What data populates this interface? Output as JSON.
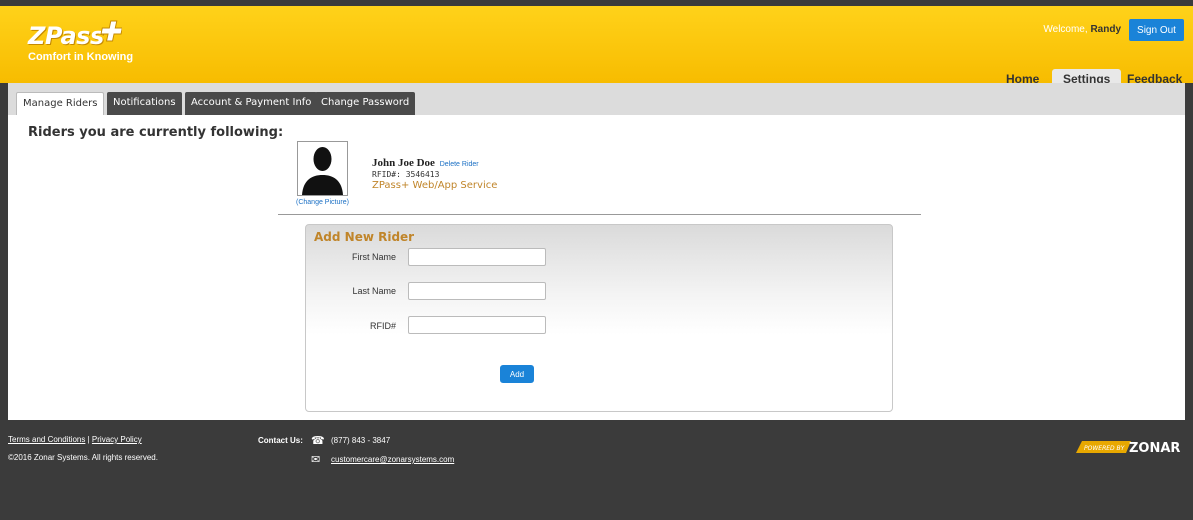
{
  "header": {
    "logo_text": "ZPass",
    "tagline": "Comfort in Knowing",
    "welcome_prefix": "Welcome,",
    "user_name": "Randy",
    "signout_label": "Sign Out",
    "nav": [
      {
        "label": "Home"
      },
      {
        "label": "Settings",
        "active": true
      },
      {
        "label": "Feedback"
      }
    ],
    "brand_color": "#f7bc00"
  },
  "tabs": [
    {
      "label": "Manage Riders",
      "active": true
    },
    {
      "label": "Notifications"
    },
    {
      "label": "Account & Payment Info"
    },
    {
      "label": "Change Password"
    }
  ],
  "main": {
    "heading": "Riders you are currently following:",
    "rider": {
      "name": "John Joe Doe",
      "delete_label": "Delete Rider",
      "rfid": "RFID#: 3546413",
      "service": "ZPass+ Web/App Service",
      "change_picture": "(Change Picture)",
      "avatar_icon": "person-silhouette-icon"
    },
    "add_form": {
      "title": "Add New Rider",
      "first_name_label": "First Name",
      "first_name_value": "",
      "last_name_label": "Last Name",
      "last_name_value": "",
      "rfid_label": "RFID#",
      "rfid_value": "",
      "add_label": "Add"
    }
  },
  "footer": {
    "terms": "Terms and Conditions",
    "separator": "|",
    "privacy": "Privacy Policy",
    "copyright": "©2016 Zonar Systems. All rights reserved.",
    "contact_label": "Contact Us:",
    "phone": "(877) 843 - 3847",
    "email": "customercare@zonarsystems.com",
    "powered_by": "POWERED BY",
    "zonar_logo": "ZONAR",
    "phone_icon": "phone-icon",
    "mail_icon": "envelope-icon"
  }
}
